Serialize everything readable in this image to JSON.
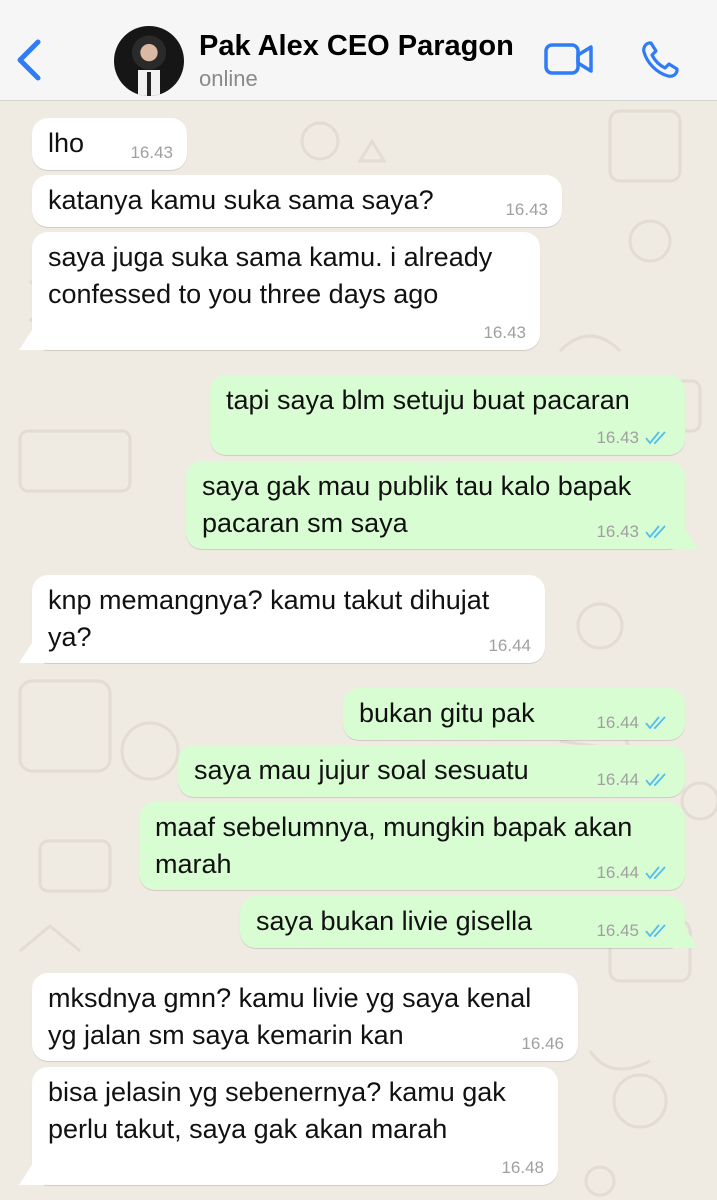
{
  "header": {
    "contact_name": "Pak Alex CEO Paragon",
    "status": "online",
    "accent_color": "#2f7cf6",
    "icons": [
      "chevron-left-icon",
      "video-call-icon",
      "phone-icon"
    ]
  },
  "messages": [
    {
      "direction": "incoming",
      "text": "lho",
      "time": "16.43"
    },
    {
      "direction": "incoming",
      "text": "katanya kamu suka sama saya?",
      "time": "16.43"
    },
    {
      "direction": "incoming",
      "text": "saya juga suka sama kamu. i already confessed to you three days ago",
      "time": "16.43"
    },
    {
      "direction": "outgoing",
      "text": "tapi saya blm setuju buat pacaran",
      "time": "16.43",
      "read": true
    },
    {
      "direction": "outgoing",
      "text": "saya gak mau publik tau kalo bapak pacaran sm saya",
      "time": "16.43",
      "read": true
    },
    {
      "direction": "incoming",
      "text": "knp memangnya? kamu takut dihujat ya?",
      "time": "16.44"
    },
    {
      "direction": "outgoing",
      "text": "bukan gitu pak",
      "time": "16.44",
      "read": true
    },
    {
      "direction": "outgoing",
      "text": "saya mau jujur soal sesuatu",
      "time": "16.44",
      "read": true
    },
    {
      "direction": "outgoing",
      "text": "maaf sebelumnya, mungkin bapak akan marah",
      "time": "16.44",
      "read": true
    },
    {
      "direction": "outgoing",
      "text": "saya bukan livie gisella",
      "time": "16.45",
      "read": true
    },
    {
      "direction": "incoming",
      "text": "mksdnya gmn? kamu livie yg saya kenal yg jalan sm saya kemarin kan",
      "time": "16.46"
    },
    {
      "direction": "incoming",
      "text": "bisa jelasin yg sebenernya? kamu gak perlu takut, saya gak akan marah",
      "time": "16.48"
    }
  ],
  "colors": {
    "incoming_bubble": "#ffffff",
    "outgoing_bubble": "#d9fdd3",
    "wallpaper": "#efeae2",
    "read_ticks": "#53bdeb"
  }
}
